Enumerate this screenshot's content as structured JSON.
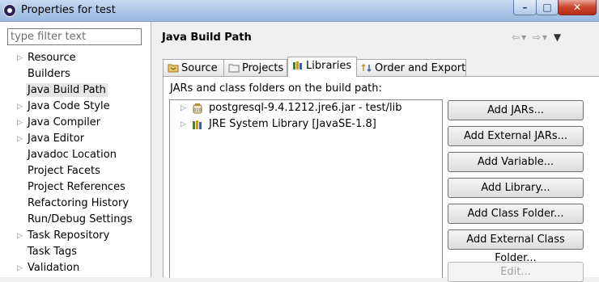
{
  "window": {
    "title": "Properties for test"
  },
  "filter": {
    "placeholder": "type filter text"
  },
  "nav": [
    {
      "label": "Resource",
      "expandable": true
    },
    {
      "label": "Builders",
      "expandable": false
    },
    {
      "label": "Java Build Path",
      "expandable": false,
      "selected": true
    },
    {
      "label": "Java Code Style",
      "expandable": true
    },
    {
      "label": "Java Compiler",
      "expandable": true
    },
    {
      "label": "Java Editor",
      "expandable": true
    },
    {
      "label": "Javadoc Location",
      "expandable": false
    },
    {
      "label": "Project Facets",
      "expandable": false
    },
    {
      "label": "Project References",
      "expandable": false
    },
    {
      "label": "Refactoring History",
      "expandable": false
    },
    {
      "label": "Run/Debug Settings",
      "expandable": false
    },
    {
      "label": "Task Repository",
      "expandable": true
    },
    {
      "label": "Task Tags",
      "expandable": false
    },
    {
      "label": "Validation",
      "expandable": true
    }
  ],
  "page": {
    "title": "Java Build Path"
  },
  "tabs": [
    {
      "label": "Source",
      "icon": "source-folder-icon"
    },
    {
      "label": "Projects",
      "icon": "projects-folder-icon"
    },
    {
      "label": "Libraries",
      "icon": "libraries-icon",
      "active": true
    },
    {
      "label": "Order and Export",
      "icon": "order-export-icon"
    }
  ],
  "libraries": {
    "label": "JARs and class folders on the build path:",
    "items": [
      {
        "label": "postgresql-9.4.1212.jre6.jar - test/lib",
        "icon": "jar-icon"
      },
      {
        "label": "JRE System Library [JavaSE-1.8]",
        "icon": "library-icon"
      }
    ],
    "buttons": [
      {
        "label": "Add JARs...",
        "enabled": true
      },
      {
        "label": "Add External JARs...",
        "enabled": true
      },
      {
        "label": "Add Variable...",
        "enabled": true
      },
      {
        "label": "Add Library...",
        "enabled": true
      },
      {
        "label": "Add Class Folder...",
        "enabled": true
      },
      {
        "label": "Add External Class Folder...",
        "enabled": true
      },
      {
        "label": "Edit...",
        "enabled": false
      }
    ]
  }
}
